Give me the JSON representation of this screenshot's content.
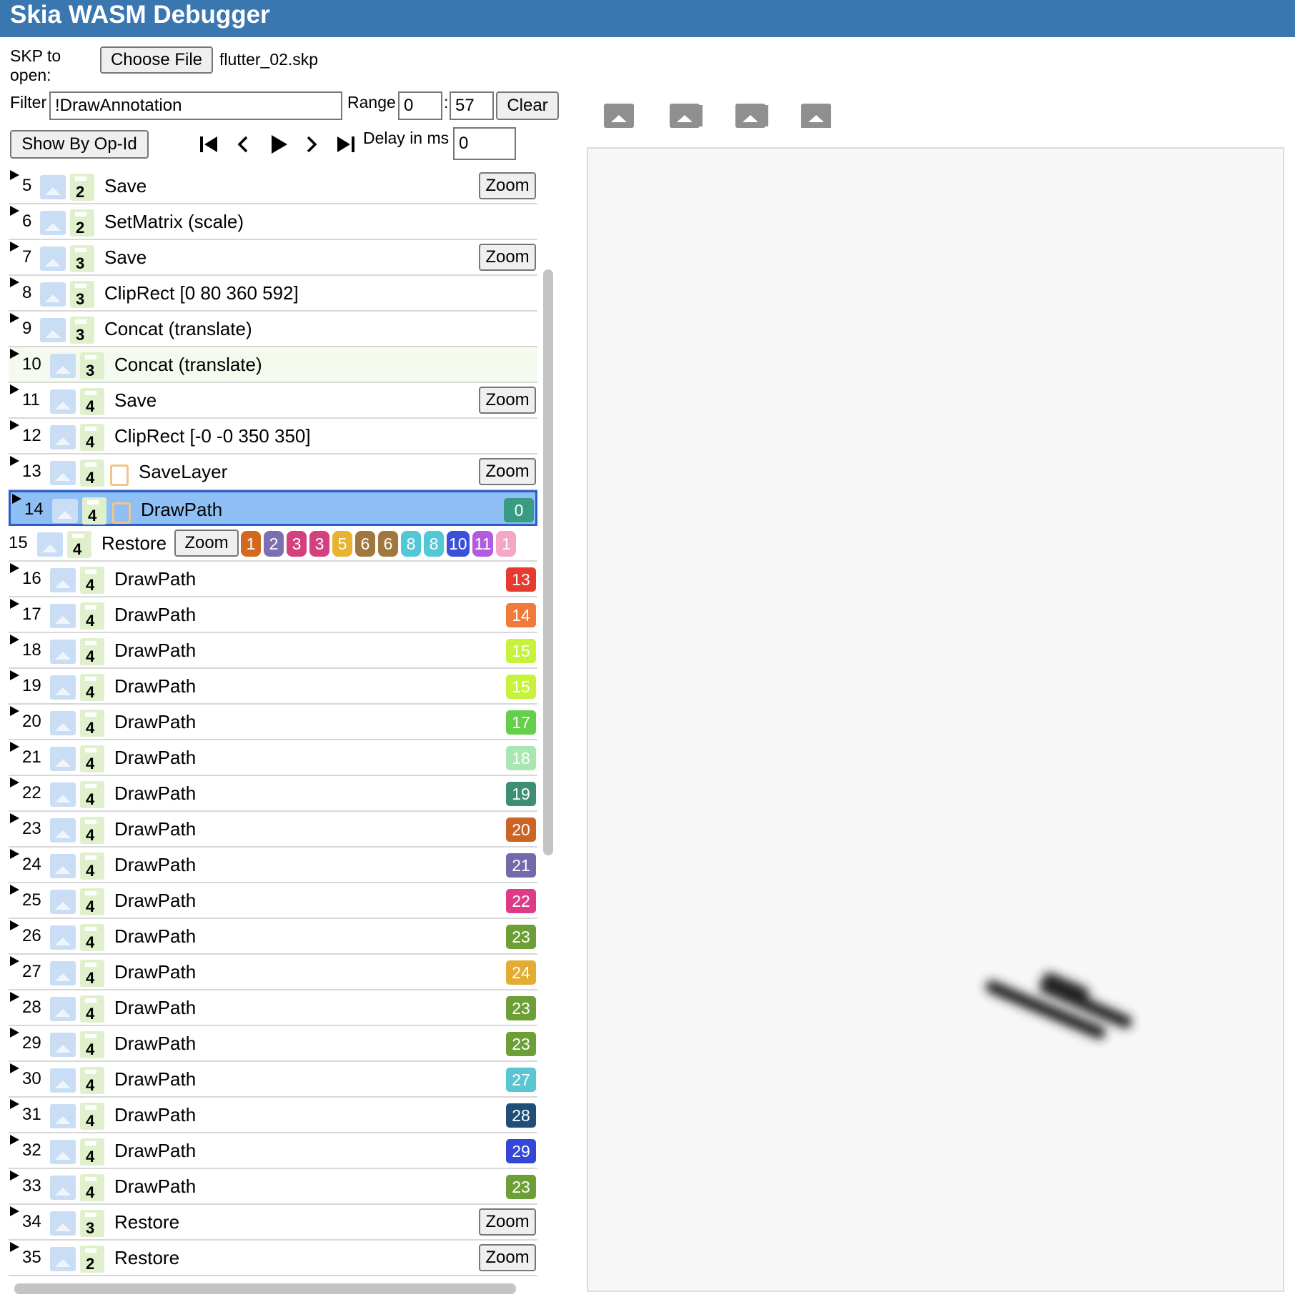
{
  "app": {
    "title": "Skia WASM Debugger"
  },
  "file": {
    "label": "SKP to open:",
    "choose_label": "Choose File",
    "filename": "flutter_02.skp"
  },
  "filter": {
    "label": "Filter",
    "value": "!DrawAnnotation"
  },
  "range": {
    "label": "Range",
    "start": "0",
    "sep": ":",
    "end": "57",
    "clear_label": "Clear"
  },
  "toolbar": {
    "show_by_opid_label": "Show By Op-Id",
    "delay_label": "Delay in ms",
    "delay_value": "0"
  },
  "player": {
    "icons": [
      "skip-to-start-icon",
      "step-back-icon",
      "play-icon",
      "step-forward-icon",
      "skip-to-end-icon"
    ]
  },
  "viewer": {
    "icons": [
      "image-icon",
      "image-stack-icon",
      "image-overlay-icon",
      "image-base-icon"
    ]
  },
  "colors": {
    "titlebar": "#3a77b0",
    "selected_row": "#8ebff5",
    "selected_border": "#2a5fc8",
    "alt_row": "#f4fbee"
  },
  "commands": [
    {
      "id": "5",
      "depth": "2",
      "name": "Save",
      "zoom": "Zoom"
    },
    {
      "id": "6",
      "depth": "2",
      "name": "SetMatrix (scale)"
    },
    {
      "id": "7",
      "depth": "3",
      "name": "Save",
      "zoom": "Zoom"
    },
    {
      "id": "8",
      "depth": "3",
      "name": "ClipRect [0 80 360 592]"
    },
    {
      "id": "9",
      "depth": "3",
      "name": "Concat (translate)"
    },
    {
      "id": "10",
      "depth": "3",
      "name": "Concat (translate)",
      "alt": true
    },
    {
      "id": "11",
      "depth": "4",
      "name": "Save",
      "zoom": "Zoom"
    },
    {
      "id": "12",
      "depth": "4",
      "name": "ClipRect [-0 -0 350 350]"
    },
    {
      "id": "13",
      "depth": "4",
      "name": "SaveLayer",
      "zoom": "Zoom",
      "layer": true
    },
    {
      "id": "14",
      "depth": "4",
      "name": "DrawPath",
      "layer": true,
      "selected": true,
      "badge": "0",
      "badge_color": "#3a9b84"
    },
    {
      "id": "15",
      "depth": "4",
      "name": "Restore",
      "zoom": "Zoom",
      "restore": true,
      "badges": [
        {
          "t": "1",
          "c": "#d2691e"
        },
        {
          "t": "2",
          "c": "#7b6fb0"
        },
        {
          "t": "3",
          "c": "#d43f7e"
        },
        {
          "t": "3",
          "c": "#d43f7e"
        },
        {
          "t": "5",
          "c": "#e9b22f"
        },
        {
          "t": "6",
          "c": "#a0773f"
        },
        {
          "t": "6",
          "c": "#a0773f"
        },
        {
          "t": "8",
          "c": "#52c7d6"
        },
        {
          "t": "8",
          "c": "#52c7d6"
        },
        {
          "t": "10",
          "c": "#3a50d8"
        },
        {
          "t": "11",
          "c": "#b25ae0"
        },
        {
          "t": "1",
          "c": "#f3a6c6"
        }
      ]
    },
    {
      "id": "16",
      "depth": "4",
      "name": "DrawPath",
      "badge": "13",
      "badge_color": "#e53c2f"
    },
    {
      "id": "17",
      "depth": "4",
      "name": "DrawPath",
      "badge": "14",
      "badge_color": "#ef7a3a"
    },
    {
      "id": "18",
      "depth": "4",
      "name": "DrawPath",
      "badge": "15",
      "badge_color": "#c6f23c"
    },
    {
      "id": "19",
      "depth": "4",
      "name": "DrawPath",
      "badge": "15",
      "badge_color": "#c6f23c"
    },
    {
      "id": "20",
      "depth": "4",
      "name": "DrawPath",
      "badge": "17",
      "badge_color": "#63cf4a"
    },
    {
      "id": "21",
      "depth": "4",
      "name": "DrawPath",
      "badge": "18",
      "badge_color": "#a9e7b2"
    },
    {
      "id": "22",
      "depth": "4",
      "name": "DrawPath",
      "badge": "19",
      "badge_color": "#3c8f73"
    },
    {
      "id": "23",
      "depth": "4",
      "name": "DrawPath",
      "badge": "20",
      "badge_color": "#cd6424"
    },
    {
      "id": "24",
      "depth": "4",
      "name": "DrawPath",
      "badge": "21",
      "badge_color": "#7469ab"
    },
    {
      "id": "25",
      "depth": "4",
      "name": "DrawPath",
      "badge": "22",
      "badge_color": "#dd3b87"
    },
    {
      "id": "26",
      "depth": "4",
      "name": "DrawPath",
      "badge": "23",
      "badge_color": "#6c9f35"
    },
    {
      "id": "27",
      "depth": "4",
      "name": "DrawPath",
      "badge": "24",
      "badge_color": "#e3ad33"
    },
    {
      "id": "28",
      "depth": "4",
      "name": "DrawPath",
      "badge": "23",
      "badge_color": "#6c9f35"
    },
    {
      "id": "29",
      "depth": "4",
      "name": "DrawPath",
      "badge": "23",
      "badge_color": "#6c9f35"
    },
    {
      "id": "30",
      "depth": "4",
      "name": "DrawPath",
      "badge": "27",
      "badge_color": "#5ac5d3"
    },
    {
      "id": "31",
      "depth": "4",
      "name": "DrawPath",
      "badge": "28",
      "badge_color": "#1f4f78"
    },
    {
      "id": "32",
      "depth": "4",
      "name": "DrawPath",
      "badge": "29",
      "badge_color": "#3447d6"
    },
    {
      "id": "33",
      "depth": "4",
      "name": "DrawPath",
      "badge": "23",
      "badge_color": "#6c9f35"
    },
    {
      "id": "34",
      "depth": "3",
      "name": "Restore",
      "zoom": "Zoom"
    },
    {
      "id": "35",
      "depth": "2",
      "name": "Restore",
      "zoom": "Zoom"
    }
  ]
}
